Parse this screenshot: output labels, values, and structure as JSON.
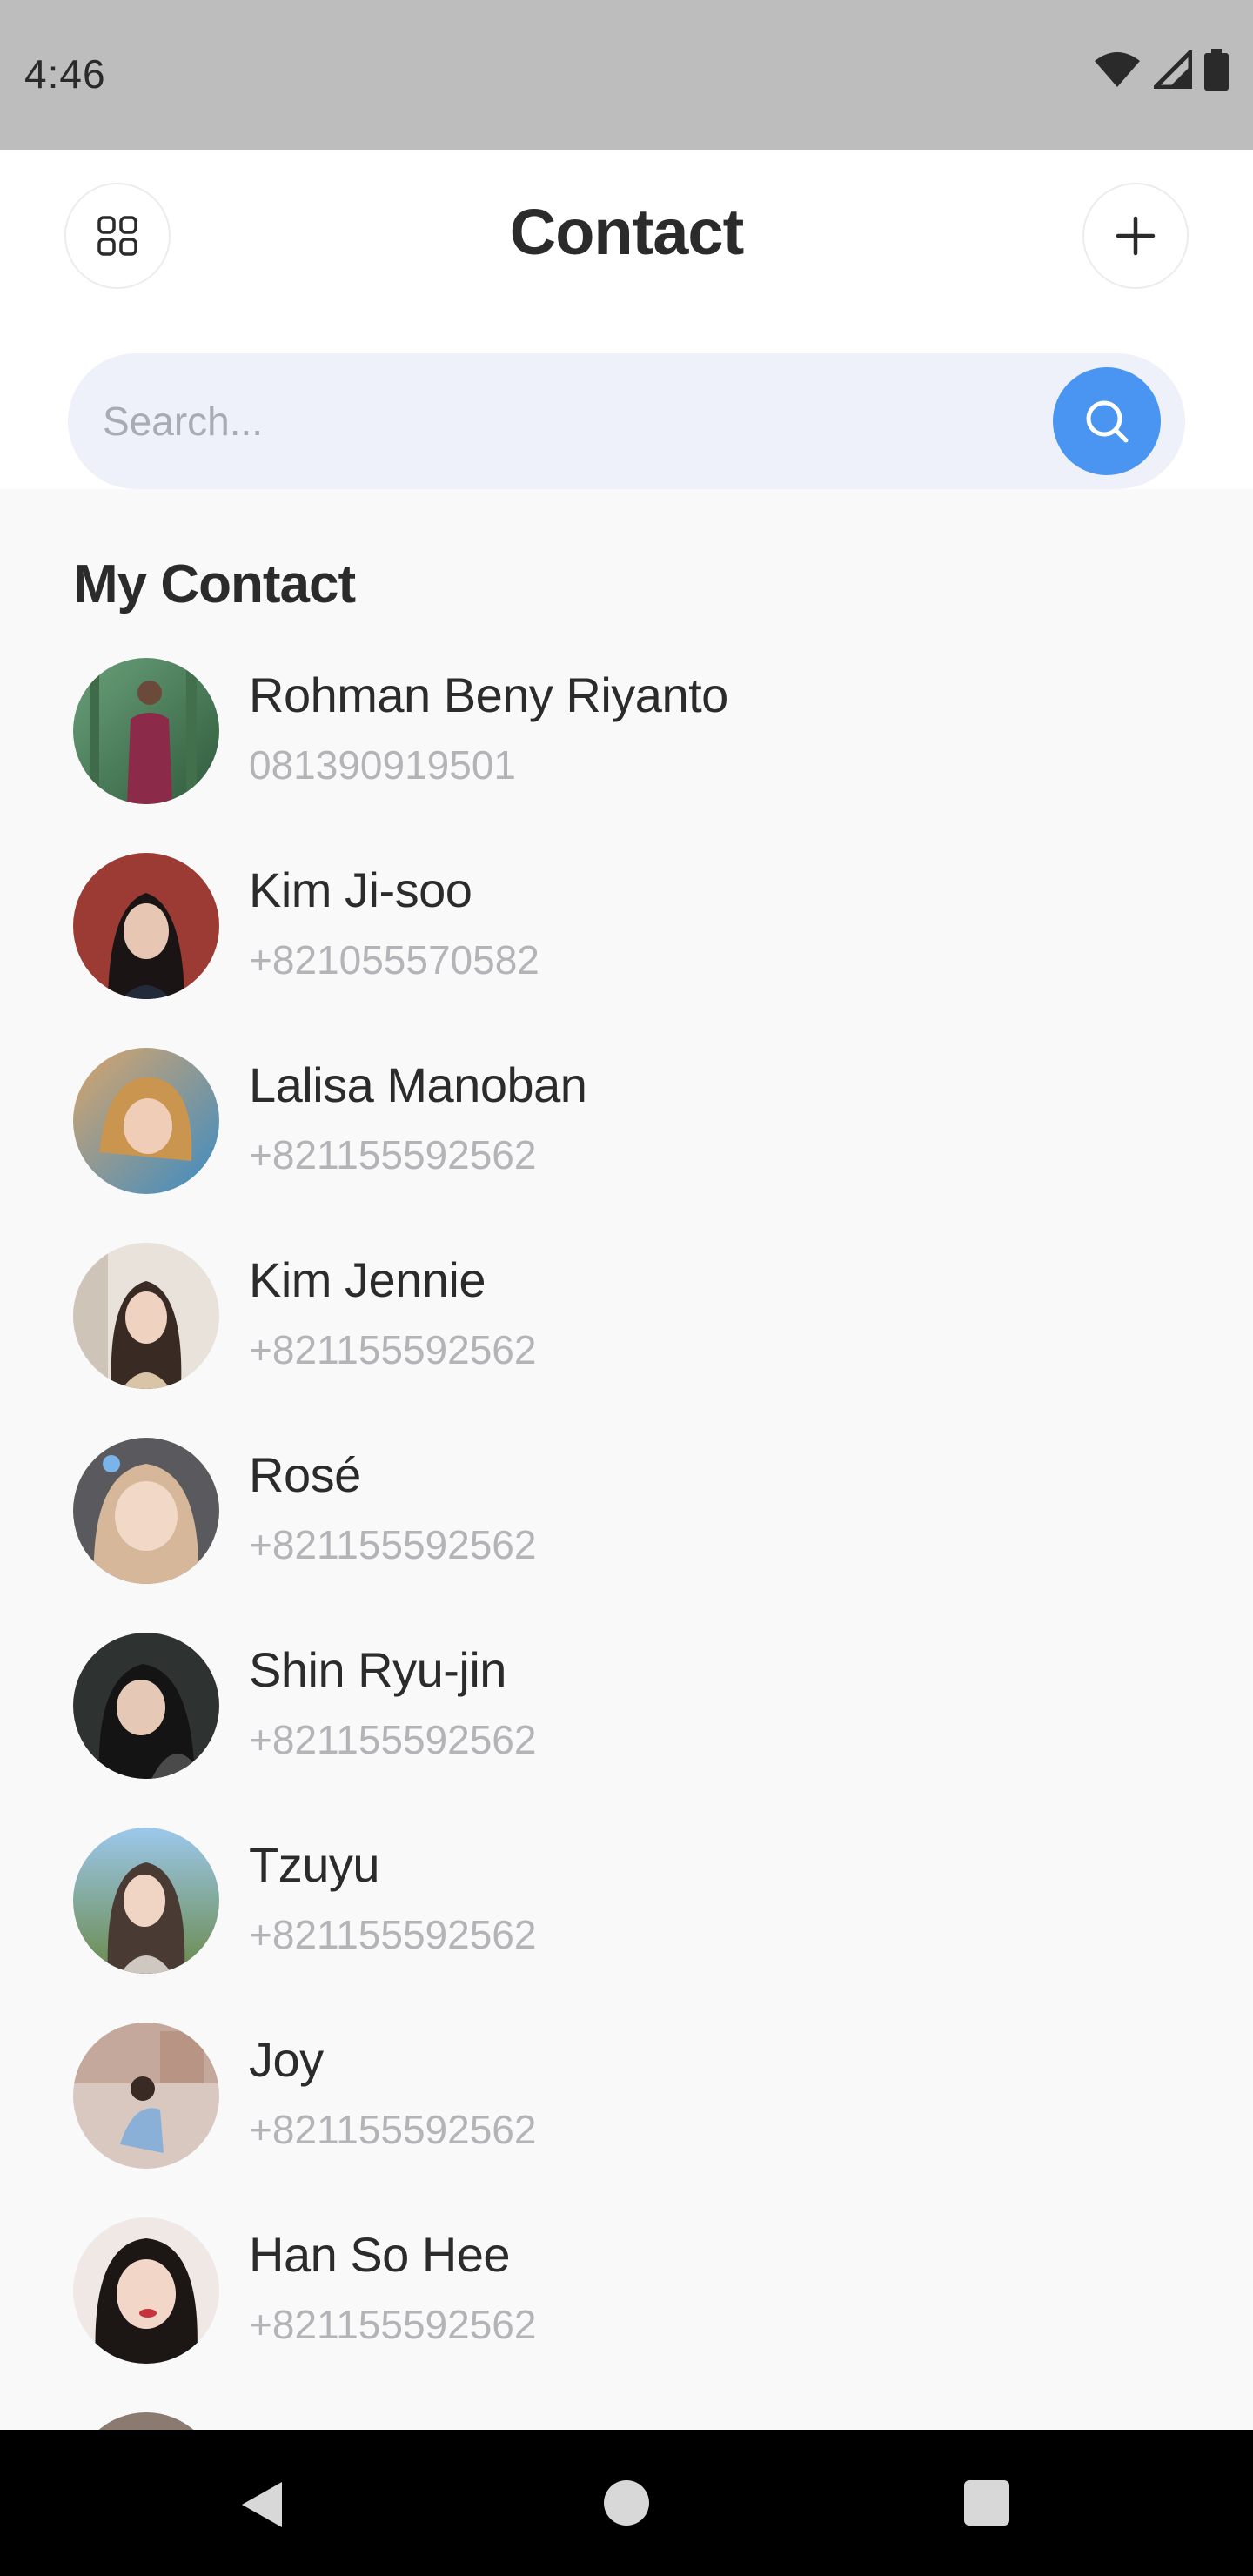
{
  "status_bar": {
    "time": "4:46",
    "icons": [
      "wifi-icon",
      "signal-icon",
      "battery-icon"
    ]
  },
  "header": {
    "title": "Contact",
    "left_icon": "grid-icon",
    "right_icon": "plus-icon"
  },
  "search": {
    "placeholder": "Search...",
    "value": "",
    "button_icon": "search-icon",
    "accent_color": "#4a95f2"
  },
  "section": {
    "title": "My Contact"
  },
  "contacts": [
    {
      "name": "Rohman Beny Riyanto",
      "phone": "081390919501",
      "avatar": "avatar-photo"
    },
    {
      "name": "Kim Ji-soo",
      "phone": "+821055570582",
      "avatar": "avatar-photo"
    },
    {
      "name": "Lalisa Manoban",
      "phone": "+821155592562",
      "avatar": "avatar-photo"
    },
    {
      "name": "Kim Jennie",
      "phone": "+821155592562",
      "avatar": "avatar-photo"
    },
    {
      "name": "Rosé",
      "phone": "+821155592562",
      "avatar": "avatar-photo"
    },
    {
      "name": "Shin Ryu-jin",
      "phone": "+821155592562",
      "avatar": "avatar-photo"
    },
    {
      "name": "Tzuyu",
      "phone": "+821155592562",
      "avatar": "avatar-photo"
    },
    {
      "name": "Joy",
      "phone": "+821155592562",
      "avatar": "avatar-photo"
    },
    {
      "name": "Han So Hee",
      "phone": "+821155592562",
      "avatar": "avatar-photo"
    }
  ],
  "nav_bar": {
    "icons": [
      "back-icon",
      "home-icon",
      "recents-icon"
    ]
  }
}
